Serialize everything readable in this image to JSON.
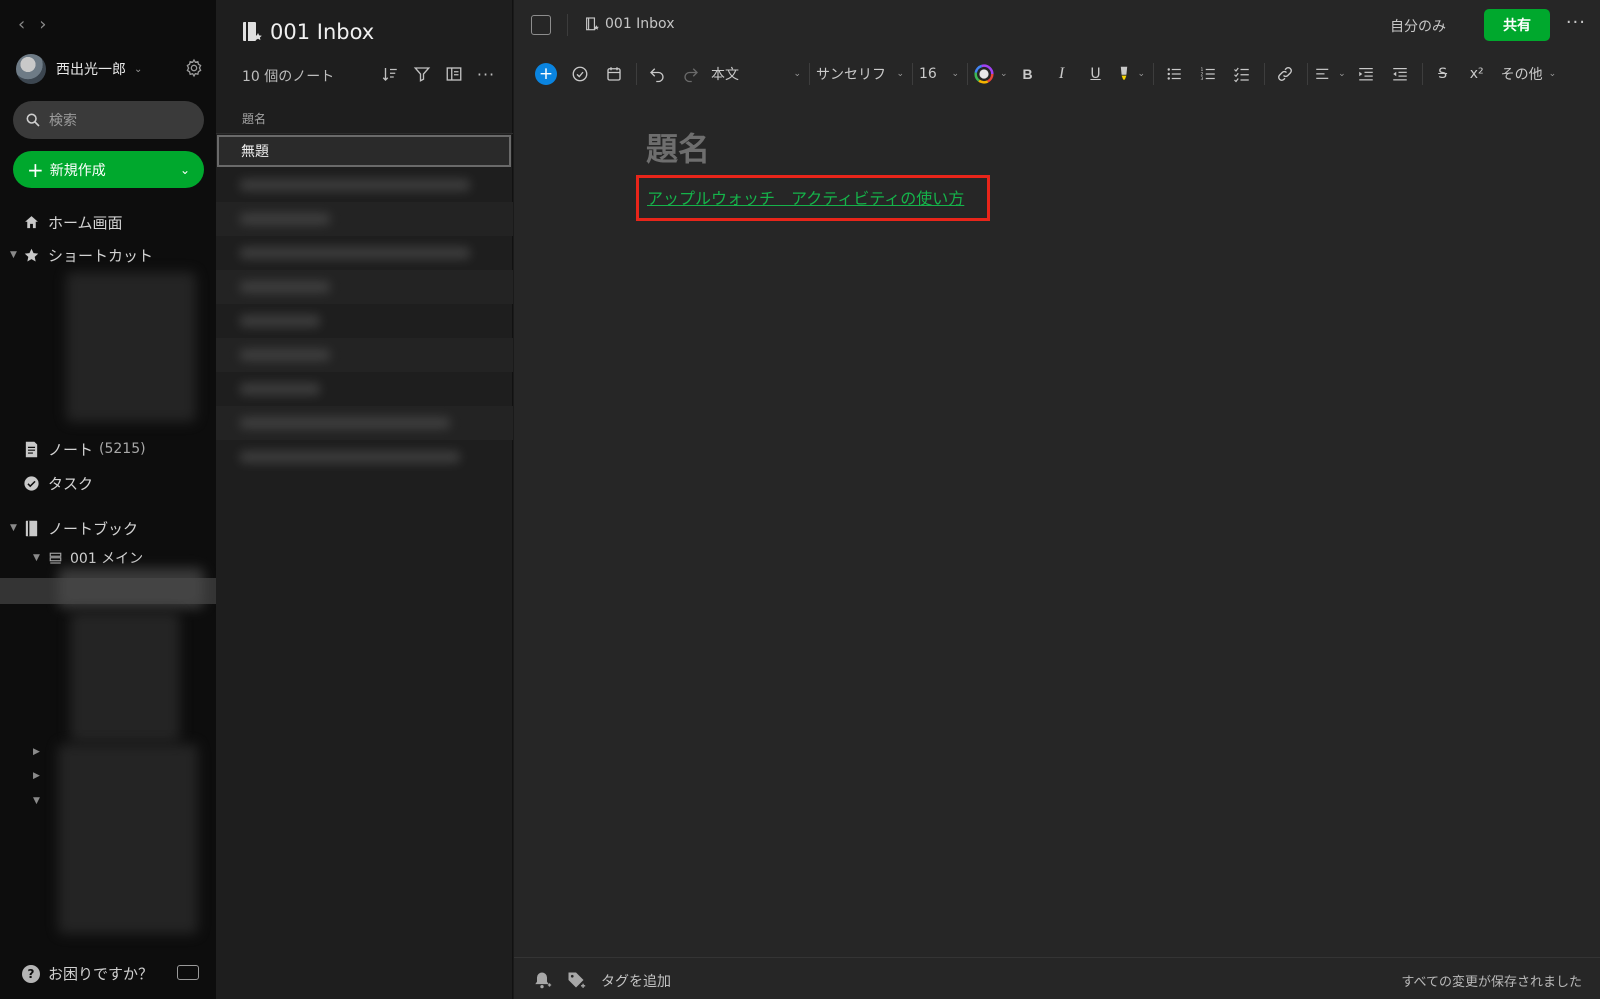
{
  "sidebar": {
    "user_name": "西出光一郎",
    "search_placeholder": "検索",
    "new_label": "新規作成",
    "home_label": "ホーム画面",
    "shortcuts_label": "ショートカット",
    "notes_label": "ノート",
    "notes_count": "(5215)",
    "tasks_label": "タスク",
    "notebooks_label": "ノートブック",
    "stack_label": "001 メイン",
    "help_label": "お困りですか？"
  },
  "notelist": {
    "title": "001 Inbox",
    "count_label": "10 個のノート",
    "column_header": "題名",
    "selected_note": "無題"
  },
  "editor": {
    "breadcrumb": "001 Inbox",
    "share_scope": "自分のみ",
    "share_label": "共有",
    "toolbar": {
      "style": "本文",
      "font": "サンセリフ",
      "size": "16",
      "bold": "B",
      "italic": "I",
      "underline": "U",
      "strike": "S",
      "superscript": "x²",
      "more": "その他"
    },
    "note_title_placeholder": "題名",
    "link_text": "アップルウォッチ　アクティビティの使い方",
    "add_tag": "タグを追加",
    "save_status": "すべての変更が保存されました"
  },
  "colors": {
    "accent_green": "#00a82d",
    "link_green": "#15b34a",
    "highlight_red": "#e8251a",
    "add_blue": "#0a84e0"
  }
}
